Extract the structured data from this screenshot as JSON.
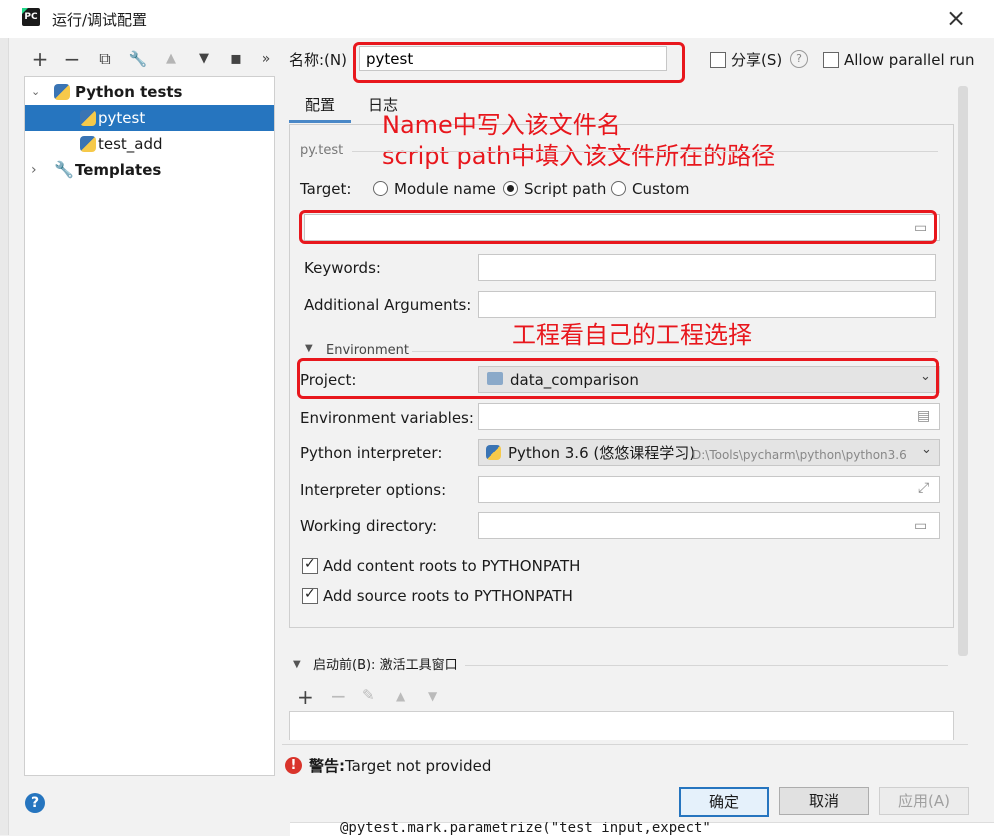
{
  "window": {
    "title": "运行/调试配置",
    "close_icon": "×"
  },
  "toolbar": {
    "add": "+",
    "remove": "−",
    "copy": "⧉",
    "wrench": "🔧",
    "up": "▲",
    "down": "▼",
    "folder": "▪",
    "more": "»"
  },
  "tree": {
    "group_label": "Python tests",
    "items": [
      {
        "label": "pytest"
      },
      {
        "label": "test_add"
      }
    ],
    "templates_label": "Templates"
  },
  "name_row": {
    "label": "名称:(N)",
    "value": "pytest",
    "share_label": "分享(S)",
    "help": "?",
    "parallel_label": "Allow parallel run"
  },
  "tabs": [
    {
      "label": "配置"
    },
    {
      "label": "日志"
    }
  ],
  "annotations": {
    "note_line1": "Name中写入该文件名",
    "note_line2": "script path中填入该文件所在的路径",
    "note_project": "工程看自己的工程选择"
  },
  "config": {
    "section_title": "py.test",
    "target_label": "Target:",
    "target_options": [
      {
        "label": "Module name",
        "checked": false
      },
      {
        "label": "Script path",
        "checked": true
      },
      {
        "label": "Custom",
        "checked": false
      }
    ],
    "keywords_label": "Keywords:",
    "additional_args_label": "Additional Arguments:",
    "environment_label": "Environment",
    "project_label": "Project:",
    "project_value": "data_comparison",
    "env_vars_label": "Environment variables:",
    "interpreter_label": "Python interpreter:",
    "interpreter_value": "Python 3.6 (悠悠课程学习)",
    "interpreter_path": "D:\\Tools\\pycharm\\python\\python3.6",
    "interp_options_label": "Interpreter options:",
    "workdir_label": "Working directory:",
    "content_roots_label": "Add content roots to PYTHONPATH",
    "source_roots_label": "Add source roots to PYTHONPATH"
  },
  "before_launch": {
    "label": "启动前(B): 激活工具窗口"
  },
  "warning": {
    "bold": "警告:",
    "text": "Target not provided"
  },
  "buttons": {
    "ok": "确定",
    "cancel": "取消",
    "apply": "应用(A)"
  },
  "code_snippet": "@pytest.mark.parametrize(\"test_input,expect\""
}
